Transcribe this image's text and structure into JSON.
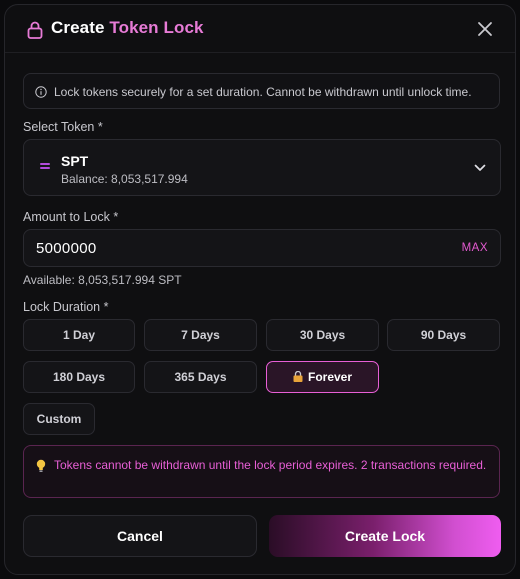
{
  "header": {
    "title_prefix": "Create",
    "title_accent": "Token Lock",
    "lock_icon": "lock-icon",
    "close_icon": "close-icon"
  },
  "info": {
    "icon": "info-icon",
    "text": "Lock tokens securely for a set duration. Cannot be withdrawn until unlock time."
  },
  "token": {
    "label": "Select Token *",
    "name": "SPT",
    "balance": "Balance: 8,053,517.994",
    "chevron_icon": "chevron-down-icon"
  },
  "amount": {
    "label": "Amount to Lock *",
    "value": "5000000",
    "max_label": "MAX",
    "available": "Available: 8,053,517.994 SPT"
  },
  "duration": {
    "label": "Lock Duration *",
    "options": [
      "1 Day",
      "7 Days",
      "30 Days",
      "90 Days",
      "180 Days",
      "365 Days",
      "Forever",
      "Custom"
    ],
    "selected": "Forever"
  },
  "warning": {
    "icon": "lightbulb-icon",
    "text": "Tokens cannot be withdrawn until the lock period expires. 2 transactions required."
  },
  "actions": {
    "cancel_label": "Cancel",
    "create_label": "Create Lock"
  },
  "colors": {
    "accent": "#e85fd6",
    "background": "#0f0f11",
    "surface": "#141417",
    "border": "#2a2a30"
  }
}
